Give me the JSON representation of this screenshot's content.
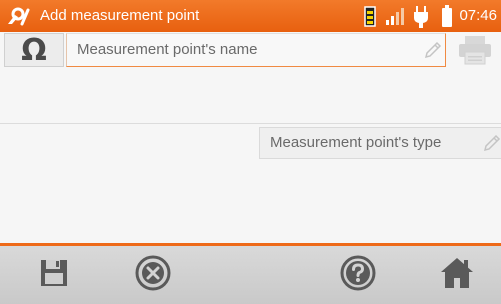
{
  "status_bar": {
    "app_icon": "wrench-probe-icon",
    "title": "Add measurement point",
    "icons": [
      "battery-level-icon",
      "signal-icon",
      "power-plug-icon",
      "battery-icon"
    ],
    "time": "07:46",
    "accent_color": "#ee6a18"
  },
  "form": {
    "ohm_button": {
      "icon": "ohm-icon",
      "glyph": "Ω"
    },
    "name_field": {
      "label": "Measurement point's name",
      "edit_icon": "pencil-icon"
    },
    "print_button": {
      "icon": "printer-icon"
    },
    "type_field": {
      "label": "Measurement point's type",
      "edit_icon": "pencil-icon"
    }
  },
  "toolbar": {
    "buttons": [
      {
        "name": "save",
        "icon": "floppy-disk-icon"
      },
      {
        "name": "cancel",
        "icon": "close-circle-icon"
      },
      {
        "name": "help",
        "icon": "question-circle-icon"
      },
      {
        "name": "home",
        "icon": "home-icon"
      }
    ]
  }
}
